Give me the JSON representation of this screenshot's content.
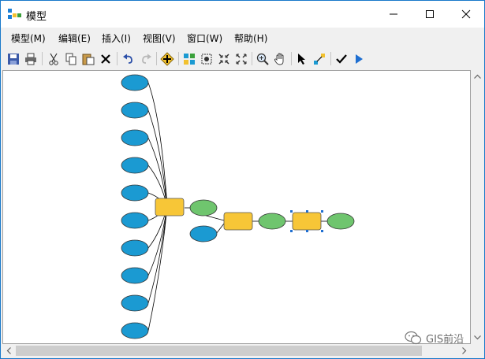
{
  "window": {
    "title": "模型",
    "minimize_icon": "minimize-icon",
    "maximize_icon": "maximize-icon",
    "close_icon": "close-icon"
  },
  "menubar": {
    "items": [
      {
        "label": "模型(M)"
      },
      {
        "label": "编辑(E)"
      },
      {
        "label": "插入(I)"
      },
      {
        "label": "视图(V)"
      },
      {
        "label": "窗口(W)"
      },
      {
        "label": "帮助(H)"
      }
    ]
  },
  "toolbar": {
    "buttons": [
      "save-icon",
      "print-icon",
      "cut-icon",
      "copy-icon",
      "paste-icon",
      "delete-icon",
      "undo-icon",
      "redo-icon",
      "add-data-icon",
      "auto-layout-icon",
      "full-extent-icon",
      "fixed-zoom-in-icon",
      "fixed-zoom-out-icon",
      "zoom-in-icon",
      "pan-icon",
      "select-icon",
      "connect-icon",
      "validate-icon",
      "run-icon"
    ]
  },
  "colors": {
    "input_data": "#1b9ad2",
    "tool": "#f7c637",
    "output_data": "#6fc56e",
    "titlebar_border": "#1979ca"
  },
  "watermark": {
    "text": "GIS前沿",
    "icon": "wechat-icon"
  }
}
